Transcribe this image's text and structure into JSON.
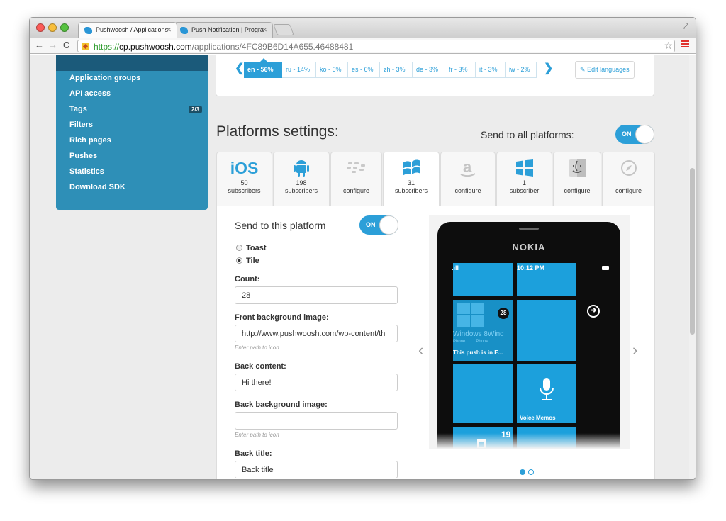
{
  "browser": {
    "tabs": [
      {
        "title": "Pushwoosh / Applications"
      },
      {
        "title": "Push Notification | Progra"
      }
    ],
    "url_proto": "https://",
    "url_host": "cp.pushwoosh.com",
    "url_path": "/applications/4FC89B6D14A655.46488481"
  },
  "sidebar": {
    "items": [
      {
        "label": "Application groups"
      },
      {
        "label": "API access"
      },
      {
        "label": "Tags",
        "badge": "2/3"
      },
      {
        "label": "Filters"
      },
      {
        "label": "Rich pages"
      },
      {
        "label": "Pushes"
      },
      {
        "label": "Statistics"
      },
      {
        "label": "Download SDK"
      }
    ]
  },
  "languages": {
    "items": [
      "en - 56%",
      "ru - 14%",
      "ko - 6%",
      "es - 6%",
      "zh - 3%",
      "de - 3%",
      "fr - 3%",
      "it - 3%",
      "iw - 2%"
    ],
    "edit_label": "Edit languages"
  },
  "platforms": {
    "title": "Platforms settings:",
    "send_all_label": "Send to all platforms:",
    "toggle_label": "ON",
    "tabs": [
      {
        "name": "iOS",
        "count": "50",
        "label": "subscribers"
      },
      {
        "name": "Android",
        "count": "198",
        "label": "subscribers"
      },
      {
        "name": "BlackBerry",
        "label": "configure"
      },
      {
        "name": "Windows Phone",
        "count": "31",
        "label": "subscribers"
      },
      {
        "name": "Amazon",
        "label": "configure"
      },
      {
        "name": "Windows",
        "count": "1",
        "label": "subscriber"
      },
      {
        "name": "Mac OS X",
        "label": "configure"
      },
      {
        "name": "Safari",
        "label": "configure"
      }
    ]
  },
  "form": {
    "send_to_platform": "Send to this platform",
    "toggle_label": "ON",
    "radio_toast": "Toast",
    "radio_tile": "Tile",
    "count_label": "Count:",
    "count_value": "28",
    "front_bg_label": "Front background image:",
    "front_bg_value": "http://www.pushwoosh.com/wp-content/th",
    "front_bg_hint": "Enter path to icon",
    "back_content_label": "Back content:",
    "back_content_value": "Hi there!",
    "back_bg_label": "Back background image:",
    "back_bg_value": "",
    "back_bg_hint": "Enter path to icon",
    "back_title_label": "Back title:",
    "back_title_value": "Back title"
  },
  "phone": {
    "brand": "NOKIA",
    "time": "10:12 PM",
    "signal": ".ıll",
    "tile_badge": "28",
    "tile_brand_1": "Windows 8Wind",
    "tile_brand_2": "Phone         Phone",
    "tile_push": "This push is in E...",
    "voice_memos": "Voice Memos",
    "tile_count": "19"
  },
  "colors": {
    "accent": "#2c9fd8",
    "sidebar": "#2e8fb7",
    "tile": "#1ca0dc"
  }
}
